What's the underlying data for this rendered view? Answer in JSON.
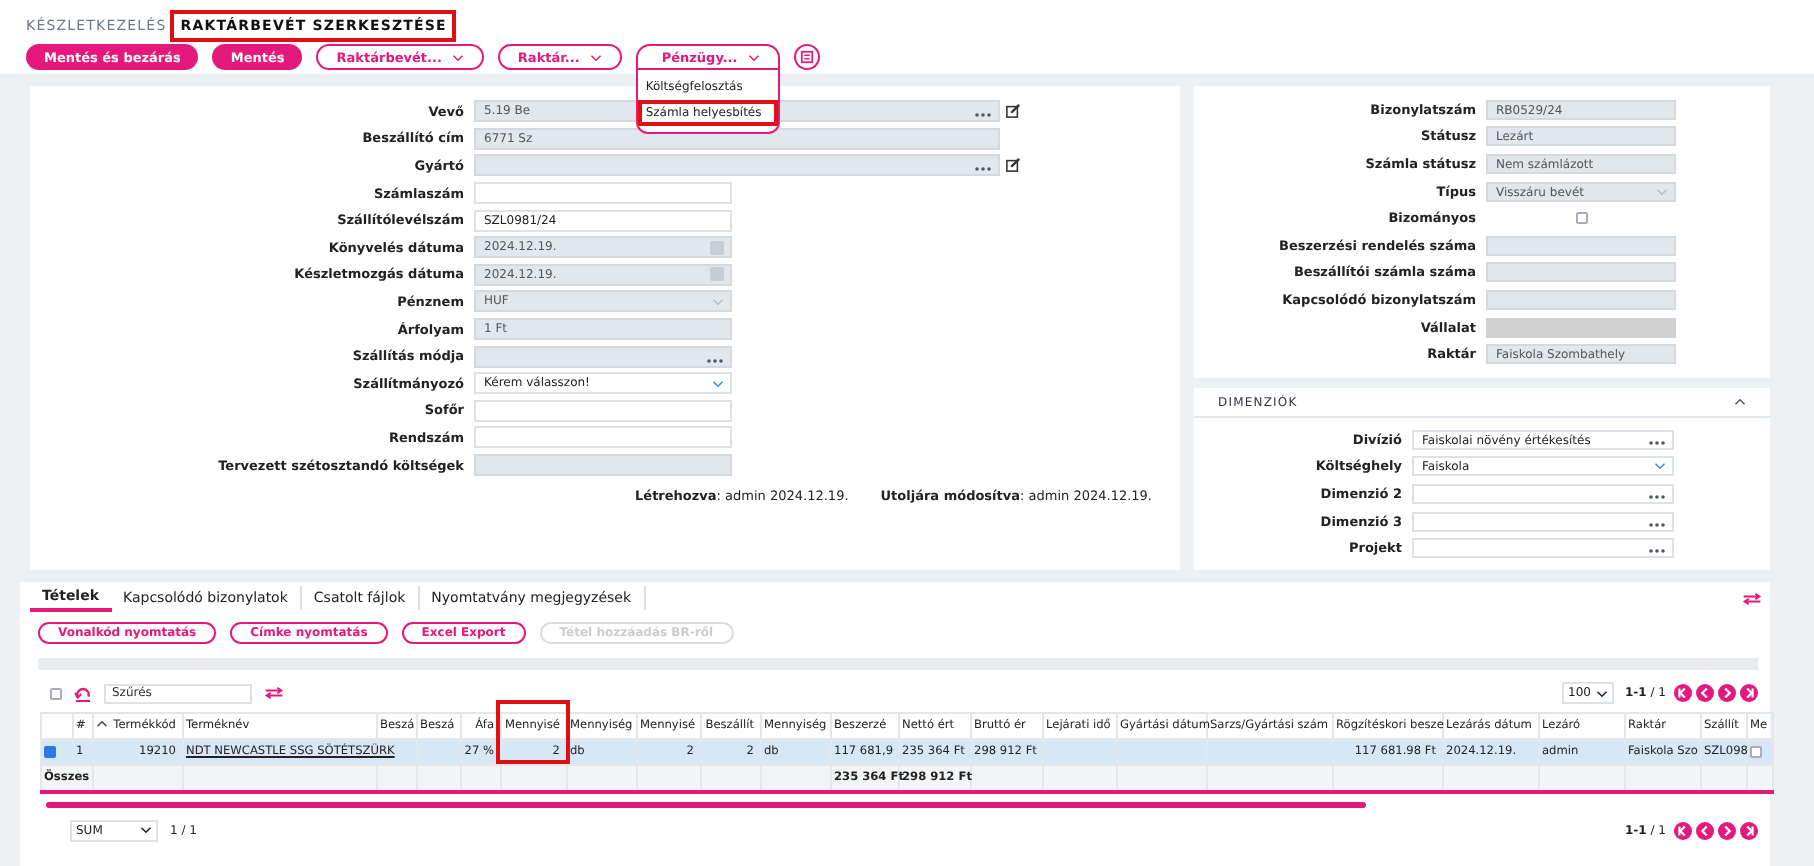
{
  "breadcrumb": [
    {
      "label": "KÉSZLETKEZELÉS",
      "highlighted": false
    },
    {
      "label": "RAKTÁRBEVÉT SZERKESZTÉSE",
      "highlighted": true
    }
  ],
  "toolbar": [
    {
      "kind": "primary",
      "label": "Mentés és bezárás"
    },
    {
      "kind": "primary",
      "label": "Mentés"
    },
    {
      "kind": "dropdown",
      "label": "Raktárbevét...",
      "expanded": false
    },
    {
      "kind": "dropdown",
      "label": "Raktár...",
      "expanded": false
    },
    {
      "kind": "dropdown",
      "label": "Pénzügy...",
      "expanded": true,
      "menu": [
        {
          "label": "Költségfelosztás",
          "highlighted": false
        },
        {
          "label": "Számla helyesbítés",
          "highlighted": true
        }
      ]
    },
    {
      "kind": "icon"
    }
  ],
  "main_form": {
    "fields": [
      {
        "label": "Vevő",
        "kind": "lookup",
        "value": "5.19 Be",
        "readonly": true,
        "wide": true,
        "editable": true
      },
      {
        "label": "Beszállító cím",
        "kind": "text",
        "value": "6771 Sz",
        "readonly": true,
        "wide": true,
        "editable": false
      },
      {
        "label": "Gyártó",
        "kind": "lookup",
        "readonly": true,
        "wide": true,
        "editable": true
      },
      {
        "label": "Számlaszám",
        "kind": "text",
        "readonly": false,
        "wide": false,
        "editable": false
      },
      {
        "label": "Szállítólevélszám",
        "kind": "text",
        "value": "SZL0981/24",
        "readonly": false,
        "wide": false,
        "editable": false
      },
      {
        "label": "Könyvelés dátuma",
        "kind": "date",
        "value": "2024.12.19.",
        "readonly": true,
        "wide": false,
        "editable": false
      },
      {
        "label": "Készletmozgás dátuma",
        "kind": "date",
        "value": "2024.12.19.",
        "readonly": true,
        "wide": false,
        "editable": false
      },
      {
        "label": "Pénznem",
        "kind": "select",
        "value": "HUF",
        "readonly": true,
        "wide": false,
        "editable": false
      },
      {
        "label": "Árfolyam",
        "kind": "text",
        "value": "1 Ft",
        "readonly": true,
        "wide": false,
        "editable": false
      },
      {
        "label": "Szállítás módja",
        "kind": "lookup",
        "readonly": true,
        "wide": false,
        "editable": false
      },
      {
        "label": "Szállítmányozó",
        "kind": "select",
        "value": "Kérem válasszon!",
        "readonly": false,
        "wide": false,
        "editable": false
      },
      {
        "label": "Sofőr",
        "kind": "text",
        "readonly": false,
        "wide": false,
        "editable": false
      },
      {
        "label": "Rendszám",
        "kind": "text",
        "readonly": false,
        "wide": false,
        "editable": false
      },
      {
        "label": "Tervezett szétosztandó költségek",
        "kind": "text",
        "readonly": true,
        "wide": false,
        "editable": false
      }
    ],
    "created": "**Létrehozva**: admin 2024.12.19.",
    "modified": "**Utoljára módosítva**: admin 2024.12.19."
  },
  "document_panel": {
    "fields": [
      {
        "label": "Bizonylatszám",
        "kind": "text",
        "value": "RB0529/24",
        "readonly": true
      },
      {
        "label": "Státusz",
        "kind": "text",
        "value": "Lezárt",
        "readonly": true
      },
      {
        "label": "Számla státusz",
        "kind": "text",
        "value": "Nem számlázott",
        "readonly": true
      },
      {
        "label": "Típus",
        "kind": "select",
        "value": "Visszáru bevét",
        "readonly": true
      },
      {
        "label": "Bizományos",
        "kind": "checkbox",
        "checked": false
      },
      {
        "label": "Beszerzési rendelés száma",
        "kind": "text",
        "readonly": true
      },
      {
        "label": "Beszállítói számla száma",
        "kind": "text",
        "readonly": true
      },
      {
        "label": "Kapcsolódó bizonylatszám",
        "kind": "text",
        "readonly": true
      },
      {
        "label": "Vállalat",
        "kind": "disabled"
      },
      {
        "label": "Raktár",
        "kind": "text",
        "value": "Faiskola Szombathely",
        "readonly": true
      }
    ]
  },
  "dimensions": {
    "title": "DIMENZIÓK",
    "expanded": true,
    "fields": [
      {
        "label": "Divízió",
        "kind": "lookup",
        "value": "Faiskolai növény értékesítés",
        "readonly": false
      },
      {
        "label": "Költséghely",
        "kind": "select",
        "value": "Faiskola",
        "readonly": false
      },
      {
        "label": "Dimenzió 2",
        "kind": "lookup",
        "readonly": false
      },
      {
        "label": "Dimenzió 3",
        "kind": "lookup",
        "readonly": false
      },
      {
        "label": "Projekt",
        "kind": "lookup",
        "readonly": false
      }
    ]
  },
  "tabs": [
    {
      "label": "Tételek",
      "selected": true
    },
    {
      "label": "Kapcsolódó bizonylatok",
      "selected": false
    },
    {
      "label": "Csatolt fájlok",
      "selected": false
    },
    {
      "label": "Nyomtatvány megjegyzések",
      "selected": false
    }
  ],
  "actions": [
    {
      "label": "Vonalkód nyomtatás",
      "disabled": false
    },
    {
      "label": "Címke nyomtatás",
      "disabled": false
    },
    {
      "label": "Excel Export",
      "disabled": false
    },
    {
      "label": "Tétel hozzáadás BR-ről",
      "disabled": true
    }
  ],
  "filter": {
    "select_all": false,
    "placeholder": "Szűrés"
  },
  "page_size": "100",
  "pagination": "**1-1** / 1",
  "table": {
    "columns": [
      {
        "label": "#",
        "kind": "text",
        "highlighted": false
      },
      {
        "label": "Termékkód",
        "kind": "number",
        "highlighted": false
      },
      {
        "label": "Terméknév",
        "kind": "link",
        "highlighted": false
      },
      {
        "label": "Beszá",
        "kind": "text",
        "highlighted": false
      },
      {
        "label": "Beszá",
        "kind": "text",
        "highlighted": false
      },
      {
        "label": "Áfa",
        "kind": "number",
        "highlighted": false
      },
      {
        "label": "Mennyisé",
        "kind": "number",
        "highlighted": true
      },
      {
        "label": "Mennyiség",
        "kind": "text",
        "highlighted": false
      },
      {
        "label": "Mennyisé",
        "kind": "number",
        "highlighted": false
      },
      {
        "label": "Beszállít",
        "kind": "number",
        "highlighted": false
      },
      {
        "label": "Mennyiség",
        "kind": "text",
        "highlighted": false
      },
      {
        "label": "Beszerzé",
        "kind": "text",
        "highlighted": false
      },
      {
        "label": "Nettó ért",
        "kind": "text",
        "highlighted": false
      },
      {
        "label": "Bruttó ér",
        "kind": "text",
        "highlighted": false
      },
      {
        "label": "Lejárati idő",
        "kind": "text",
        "highlighted": false
      },
      {
        "label": "Gyártási dátum",
        "kind": "text",
        "highlighted": false
      },
      {
        "label": "Sarzs/Gyártási szám",
        "kind": "text",
        "highlighted": false
      },
      {
        "label": "Rögzítéskori besze",
        "kind": "number",
        "highlighted": false
      },
      {
        "label": "Lezárás dátum",
        "kind": "text",
        "highlighted": false
      },
      {
        "label": "Lezáró",
        "kind": "text",
        "highlighted": false
      },
      {
        "label": "Raktár",
        "kind": "text",
        "highlighted": false
      },
      {
        "label": "Szállít",
        "kind": "text",
        "highlighted": false
      },
      {
        "label": "Me",
        "kind": "check",
        "highlighted": false
      }
    ],
    "rows": [
      {
        "selected": true,
        "checked": true,
        "last_checked": false,
        "cells": [
          "1",
          "19210",
          "NDT NEWCASTLE SSG SÖTÉTSZÜRK",
          null,
          null,
          "27 %",
          "2",
          "db",
          "2",
          "2",
          "db",
          "117 681,9",
          "235 364 Ft",
          "298 912 Ft",
          null,
          null,
          null,
          "117 681.98 Ft",
          "2024.12.19.",
          "admin",
          "Faiskola Szo",
          "SZL098"
        ]
      }
    ],
    "totals": {
      "label": "Összes",
      "cells": [
        null,
        null,
        null,
        null,
        null,
        null,
        null,
        null,
        null,
        null,
        "235 364 Ft",
        "298 912 Ft",
        null,
        null,
        null,
        null,
        null,
        null,
        null,
        null,
        null,
        null
      ]
    }
  },
  "footer": {
    "aggregate": "SUM",
    "page": "1 / 1",
    "pagination": "**1-1** / 1"
  }
}
